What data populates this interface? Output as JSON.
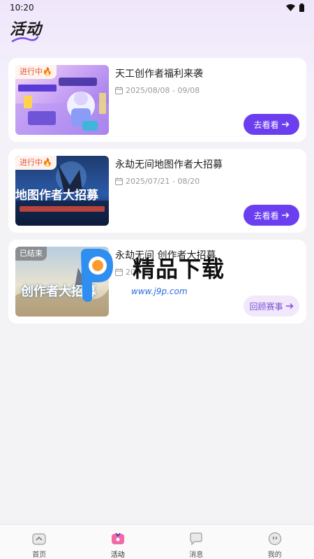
{
  "status": {
    "time": "10:20"
  },
  "page": {
    "title": "活动"
  },
  "cards": [
    {
      "badge": "进行中🔥",
      "title": "天工创作者福利来袭",
      "date": "2025/08/08 - 09/08",
      "button": "去看看"
    },
    {
      "badge": "进行中🔥",
      "title": "永劫无间地图作者大招募",
      "date": "2025/07/21 - 08/20",
      "button": "去看看",
      "banner_text": "地图作者大招募"
    },
    {
      "badge": "已结束",
      "title": "永劫无间 创作者大招募",
      "date": "20",
      "button": "回顾赛事",
      "banner_text": "创作者大招募"
    }
  ],
  "watermark": {
    "text": "精品下载",
    "url": "www.j9p.com"
  },
  "nav": {
    "items": [
      "首页",
      "活动",
      "消息",
      "我的"
    ],
    "active": "活动"
  },
  "colors": {
    "accent": "#6b3ff0",
    "badge_active": "#e4553c"
  }
}
